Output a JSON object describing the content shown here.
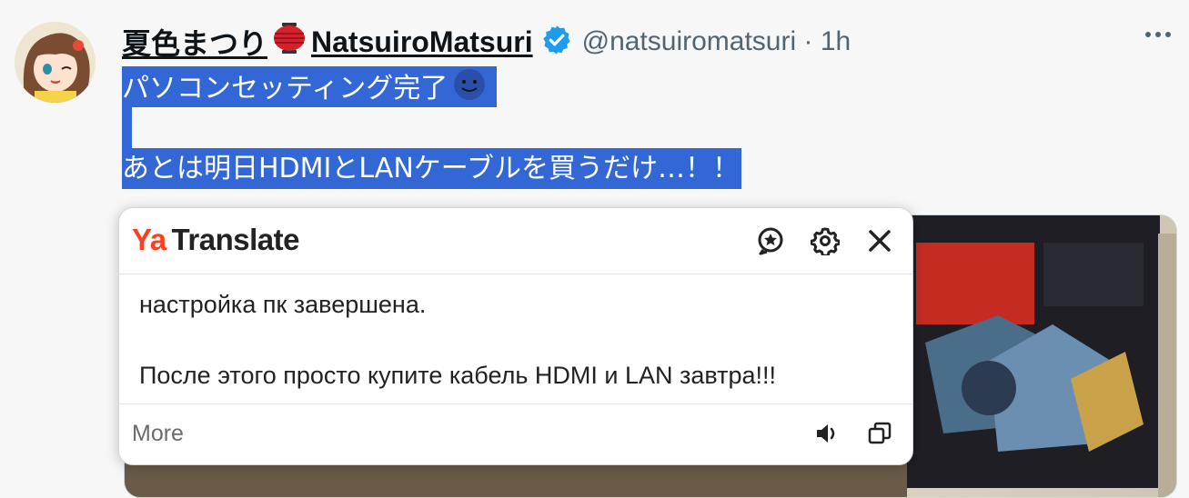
{
  "tweet": {
    "display_name": "夏色まつり",
    "display_name_en": "NatsuiroMatsuri",
    "handle": "@natsuiromatsuri",
    "separator": "·",
    "time": "1h",
    "lines": [
      "パソコンセッティング完了",
      "",
      "あとは明日HDMIとLANケーブルを買うだけ…！！"
    ]
  },
  "translate_popup": {
    "brand_ya": "Ya",
    "brand_name": "Translate",
    "translation_line1": "настройка пк завершена.",
    "translation_line2": "После этого просто купите кабель HDMI и LAN завтра!!!",
    "more_label": "More"
  },
  "icons": {
    "avatar": "anime-avatar",
    "lantern": "red-lantern-emoji",
    "verified": "verified-badge-icon",
    "more": "more-dots-icon",
    "face": "face-emoji",
    "favorite": "star-circle-icon",
    "settings": "gear-icon",
    "close": "close-icon",
    "speaker": "speaker-icon",
    "copy": "copy-icon"
  },
  "colors": {
    "selection": "#3367d6",
    "verified": "#1d9bf0",
    "brand_accent": "#fc3f1d"
  }
}
